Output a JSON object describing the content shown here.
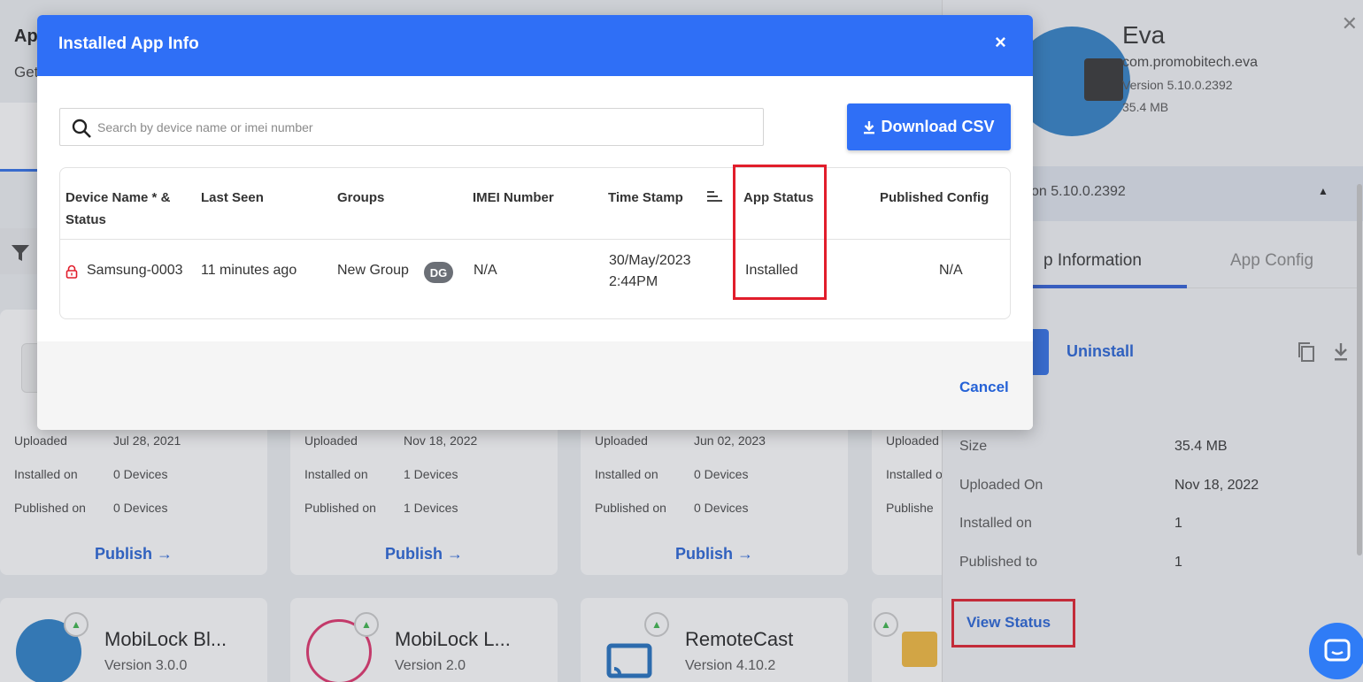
{
  "background": {
    "title": "Ap",
    "subtitle": "Get",
    "cards": [
      {
        "uploaded_label": "Uploaded",
        "uploaded": "Jul 28, 2021",
        "installed_label": "Installed on",
        "installed": "0 Devices",
        "published_label": "Published on",
        "published": "0 Devices",
        "action": "Publish"
      },
      {
        "uploaded_label": "Uploaded",
        "uploaded": "Nov 18, 2022",
        "installed_label": "Installed on",
        "installed": "1 Devices",
        "published_label": "Published on",
        "published": "1 Devices",
        "action": "Publish"
      },
      {
        "uploaded_label": "Uploaded",
        "uploaded": "Jun 02, 2023",
        "installed_label": "Installed on",
        "installed": "0 Devices",
        "published_label": "Published on",
        "published": "0 Devices",
        "action": "Publish"
      },
      {
        "uploaded_label": "Uploaded",
        "installed_label": "Installed o",
        "published_label": "Publishe"
      }
    ],
    "apps": [
      {
        "name": "MobiLock Bl...",
        "version": "Version 3.0.0"
      },
      {
        "name": "MobiLock L...",
        "version": "Version 2.0"
      },
      {
        "name": "RemoteCast",
        "version": "Version 4.10.2"
      }
    ]
  },
  "drawer": {
    "app_name": "Eva",
    "package": "com.promobitech.eva",
    "version": "Version 5.10.0.2392",
    "size": "35.4 MB",
    "version_bar": "on 5.10.0.2392",
    "tabs": {
      "info": "p Information",
      "config": "App Config"
    },
    "uninstall": "Uninstall",
    "details": [
      {
        "label": "Size",
        "value": "35.4 MB"
      },
      {
        "label": "Uploaded On",
        "value": "Nov 18, 2022"
      },
      {
        "label": "Installed on",
        "value": "1"
      },
      {
        "label": "Published to",
        "value": "1"
      }
    ],
    "view_status": "View Status"
  },
  "modal": {
    "title": "Installed App Info",
    "close": "×",
    "search_placeholder": "Search by device name or imei number",
    "download_csv": "Download CSV",
    "columns": {
      "device": "Device Name * & Status",
      "last_seen": "Last Seen",
      "groups": "Groups",
      "imei": "IMEI Number",
      "timestamp": "Time Stamp",
      "app_status": "App Status",
      "published_config": "Published Config"
    },
    "rows": [
      {
        "device": "Samsung-0003",
        "last_seen": "11 minutes ago",
        "group": "New Group",
        "group_badge": "DG",
        "imei": "N/A",
        "timestamp_date": "30/May/2023",
        "timestamp_time": "2:44PM",
        "app_status": "Installed",
        "published_config": "N/A"
      }
    ],
    "cancel": "Cancel"
  },
  "colors": {
    "primary": "#2f6ff6",
    "link": "#2562d6",
    "highlight": "#e11d2b",
    "lock": "#e11d2b",
    "badge": "#6b6f76"
  }
}
